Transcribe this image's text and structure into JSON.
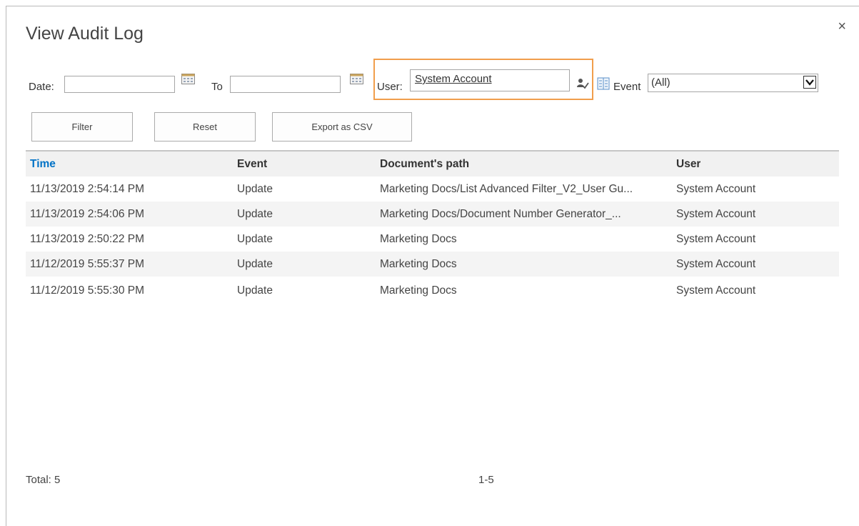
{
  "dialog": {
    "title": "View Audit Log",
    "close_label": "×"
  },
  "filters": {
    "date_label": "Date:",
    "date_value": "",
    "to_label": "To",
    "to_value": "",
    "user_label": "User:",
    "user_value": "System Account",
    "event_label": "Event",
    "event_value": "(All)"
  },
  "buttons": {
    "filter": "Filter",
    "reset": "Reset",
    "export": "Export as CSV"
  },
  "table": {
    "columns": [
      "Time",
      "Event",
      "Document's path",
      "User"
    ],
    "rows": [
      [
        "11/13/2019 2:54:14 PM",
        "Update",
        "Marketing Docs/List Advanced Filter_V2_User Gu...",
        "System Account"
      ],
      [
        "11/13/2019 2:54:06 PM",
        "Update",
        "Marketing Docs/Document Number Generator_...",
        "System Account"
      ],
      [
        "11/13/2019 2:50:22 PM",
        "Update",
        "Marketing Docs",
        "System Account"
      ],
      [
        "11/12/2019 5:55:37 PM",
        "Update",
        "Marketing Docs",
        "System Account"
      ],
      [
        "11/12/2019 5:55:30 PM",
        "Update",
        "Marketing Docs",
        "System Account"
      ]
    ]
  },
  "footer": {
    "total": "Total: 5",
    "pages": "1-5"
  },
  "colors": {
    "accent": "#0072c6",
    "highlight_border": "#f19e4c"
  }
}
